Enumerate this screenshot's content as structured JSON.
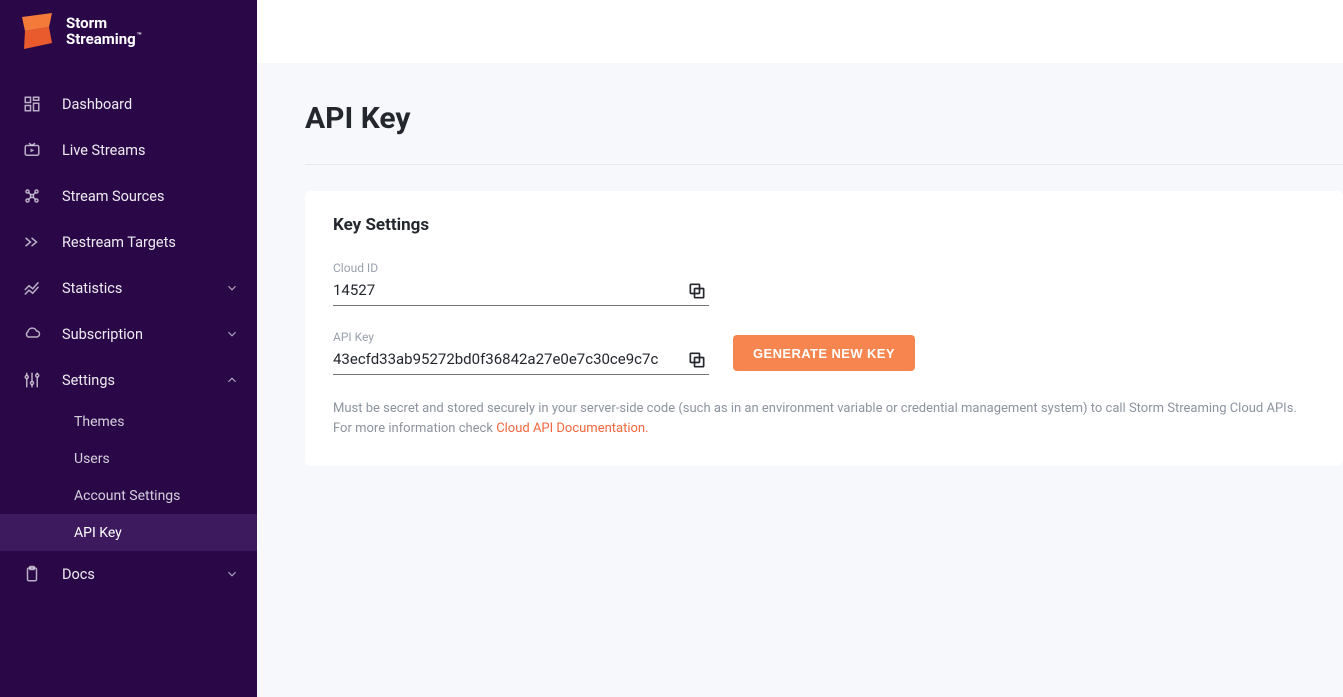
{
  "brand": {
    "name_line1": "Storm",
    "name_line2": "Streaming",
    "tm": "™"
  },
  "nav": {
    "dashboard": "Dashboard",
    "live_streams": "Live Streams",
    "stream_sources": "Stream Sources",
    "restream_targets": "Restream Targets",
    "statistics": "Statistics",
    "subscription": "Subscription",
    "settings": "Settings",
    "settings_children": {
      "themes": "Themes",
      "users": "Users",
      "account_settings": "Account Settings",
      "api_key": "API Key"
    },
    "docs": "Docs"
  },
  "page": {
    "title": "API Key",
    "card_title": "Key Settings",
    "cloud_id_label": "Cloud ID",
    "cloud_id_value": "14527",
    "api_key_label": "API Key",
    "api_key_value": "43ecfd33ab95272bd0f36842a27e0e7c30ce9c7c",
    "generate_button": "GENERATE NEW KEY",
    "note_part1": "Must be secret and stored securely in your server-side code (such as in an environment variable or credential management system) to call Storm Streaming Cloud APIs. For more information check ",
    "note_link": "Cloud API Documentation."
  },
  "colors": {
    "sidebar_bg": "#2a0848",
    "accent": "#f1663c",
    "button": "#f6854f"
  }
}
